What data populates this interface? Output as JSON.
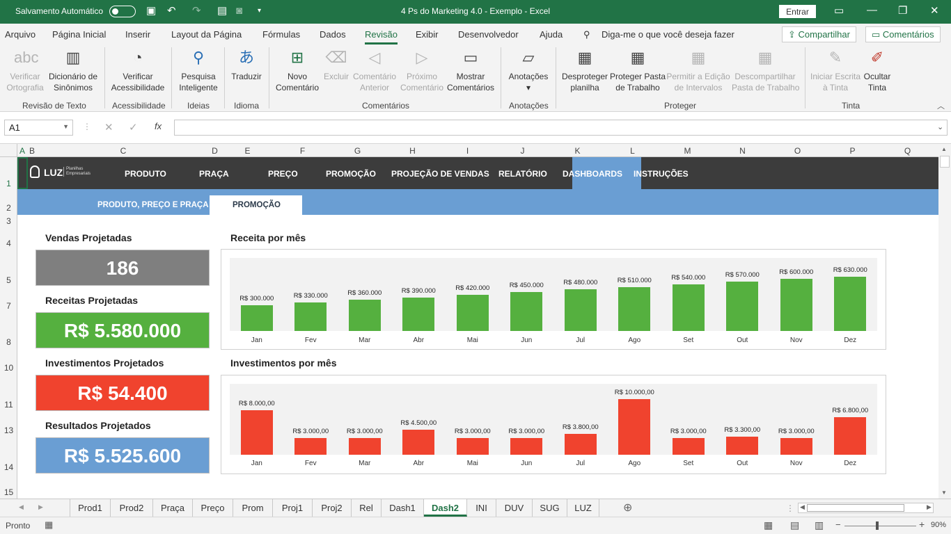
{
  "titlebar": {
    "autosave": "Salvamento Automático",
    "title": "4 Ps do Marketing 4.0 - Exemplo  -  Excel",
    "signin": "Entrar"
  },
  "menu": [
    "Arquivo",
    "Página Inicial",
    "Inserir",
    "Layout da Página",
    "Fórmulas",
    "Dados",
    "Revisão",
    "Exibir",
    "Desenvolvedor",
    "Ajuda"
  ],
  "tell_me": "Diga-me o que você deseja fazer",
  "share": "Compartilhar",
  "comments": "Comentários",
  "ribbon": {
    "b1": [
      "Verificar",
      "Ortografia"
    ],
    "b2": [
      "Dicionário de",
      "Sinônimos"
    ],
    "g1": "Revisão de Texto",
    "b3": [
      "Verificar",
      "Acessibilidade"
    ],
    "g2": "Acessibilidade",
    "b4": [
      "Pesquisa",
      "Inteligente"
    ],
    "g3": "Ideias",
    "b5": "Traduzir",
    "g4": "Idioma",
    "b6": [
      "Novo",
      "Comentário"
    ],
    "b7": "Excluir",
    "b8": [
      "Comentário",
      "Anterior"
    ],
    "b9": [
      "Próximo",
      "Comentário"
    ],
    "b10": [
      "Mostrar",
      "Comentários"
    ],
    "g5": "Comentários",
    "b11": "Anotações",
    "g6": "Anotações",
    "b12": [
      "Desproteger",
      "planilha"
    ],
    "b13": [
      "Proteger Pasta",
      "de Trabalho"
    ],
    "b14": [
      "Permitir a Edição",
      "de Intervalos"
    ],
    "b15": [
      "Descompartilhar",
      "Pasta de Trabalho"
    ],
    "g7": "Proteger",
    "b16": [
      "Iniciar Escrita",
      "à Tinta"
    ],
    "b17": [
      "Ocultar",
      "Tinta"
    ],
    "g8": "Tinta"
  },
  "namebox": "A1",
  "columns": [
    "A",
    "B",
    "C",
    "D",
    "E",
    "F",
    "G",
    "H",
    "I",
    "J",
    "K",
    "L",
    "M",
    "N",
    "O",
    "P",
    "Q"
  ],
  "rows": [
    "1",
    "2",
    "3",
    "4",
    "5",
    "7",
    "8",
    "10",
    "11",
    "13",
    "14",
    "15"
  ],
  "nav": {
    "logo": "LUZ",
    "logo_sub1": "Planilhas",
    "logo_sub2": "Empresariais",
    "items": [
      "PRODUTO",
      "PRAÇA",
      "PREÇO",
      "PROMOÇÃO",
      "PROJEÇÃO DE VENDAS",
      "RELATÓRIO",
      "DASHBOARDS",
      "INSTRUÇÕES"
    ],
    "sub": [
      "PRODUTO, PREÇO E PRAÇA",
      "PROMOÇÃO"
    ]
  },
  "kpis": [
    {
      "title": "Vendas Projetadas",
      "value": "186",
      "color": "#7f7f7f"
    },
    {
      "title": "Receitas Projetadas",
      "value": "R$ 5.580.000",
      "color": "#55b03f"
    },
    {
      "title": "Investimentos Projetados",
      "value": "R$ 54.400",
      "color": "#f0432e"
    },
    {
      "title": "Resultados Projetados",
      "value": "R$ 5.525.600",
      "color": "#6a9ed3"
    }
  ],
  "chart_data": [
    {
      "type": "bar",
      "title": "Receita por mês",
      "categories": [
        "Jan",
        "Fev",
        "Mar",
        "Abr",
        "Mai",
        "Jun",
        "Jul",
        "Ago",
        "Set",
        "Out",
        "Nov",
        "Dez"
      ],
      "values": [
        300000,
        330000,
        360000,
        390000,
        420000,
        450000,
        480000,
        510000,
        540000,
        570000,
        600000,
        630000
      ],
      "labels": [
        "R$ 300.000",
        "R$ 330.000",
        "R$ 360.000",
        "R$ 390.000",
        "R$ 420.000",
        "R$ 450.000",
        "R$ 480.000",
        "R$ 510.000",
        "R$ 540.000",
        "R$ 570.000",
        "R$ 600.000",
        "R$ 630.000"
      ],
      "color": "#55b03f",
      "ylim": [
        0,
        700000
      ],
      "grid": false
    },
    {
      "type": "bar",
      "title": "Investimentos por mês",
      "categories": [
        "Jan",
        "Fev",
        "Mar",
        "Abr",
        "Mai",
        "Jun",
        "Jul",
        "Ago",
        "Set",
        "Out",
        "Nov",
        "Dez"
      ],
      "values": [
        8000,
        3000,
        3000,
        4500,
        3000,
        3000,
        3800,
        10000,
        3000,
        3300,
        3000,
        6800
      ],
      "labels": [
        "R$ 8.000,00",
        "R$ 3.000,00",
        "R$ 3.000,00",
        "R$ 4.500,00",
        "R$ 3.000,00",
        "R$ 3.000,00",
        "R$ 3.800,00",
        "R$ 10.000,00",
        "R$ 3.000,00",
        "R$ 3.300,00",
        "R$ 3.000,00",
        "R$ 6.800,00"
      ],
      "color": "#f0432e",
      "ylim": [
        0,
        10500
      ],
      "grid": false
    }
  ],
  "sheets": [
    "Prod1",
    "Prod2",
    "Praça",
    "Preço",
    "Prom",
    "Proj1",
    "Proj2",
    "Rel",
    "Dash1",
    "Dash2",
    "INI",
    "DUV",
    "SUG",
    "LUZ"
  ],
  "active_sheet": "Dash2",
  "status": "Pronto",
  "zoom": "90%"
}
